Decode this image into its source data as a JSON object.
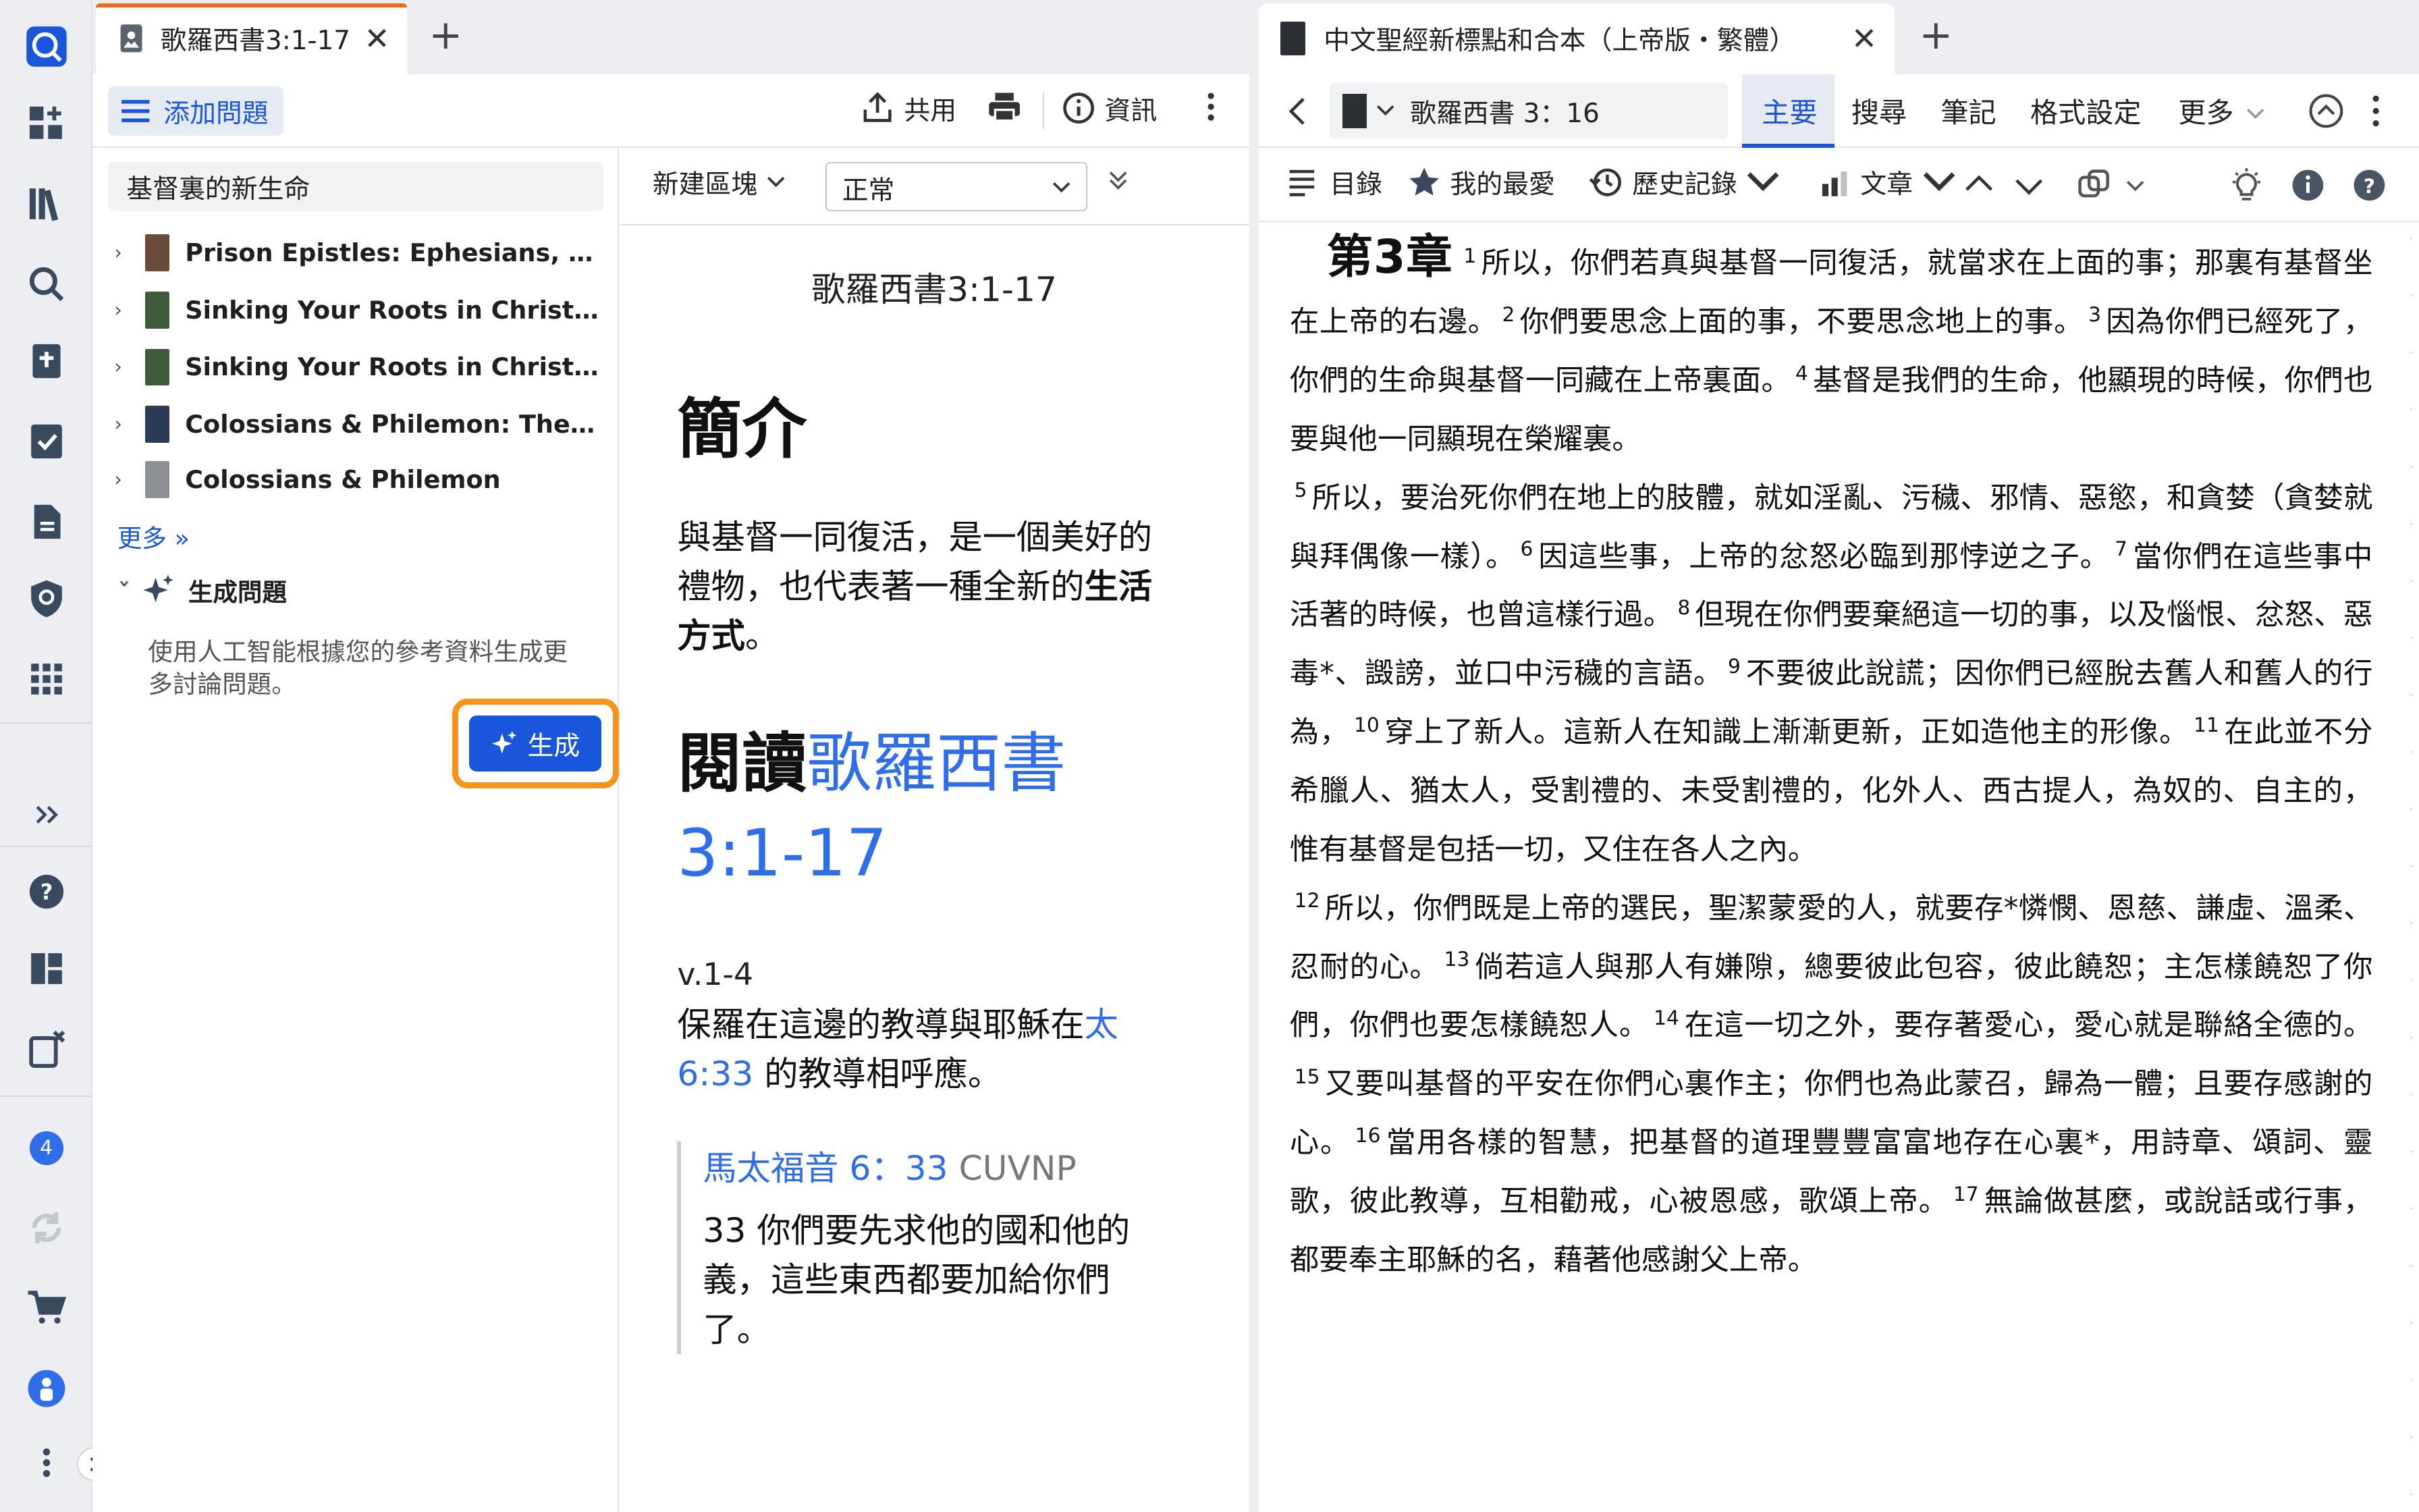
{
  "left_panel": {
    "tab_title": "歌羅西書3:1-17",
    "toolbar": {
      "add_question": "添加問題",
      "share": "共用",
      "info": "資訊"
    },
    "sidebar": {
      "search_value": "基督裏的新生命",
      "resources": [
        {
          "title": "Prison Epistles: Ephesians, Phili…",
          "color": "#6b4a3a"
        },
        {
          "title": "Sinking Your Roots in Christ: A …",
          "color": "#3f5a3a"
        },
        {
          "title": "Sinking Your Roots in Christ: A …",
          "color": "#3f5a3a"
        },
        {
          "title": "Colossians & Philemon: The Lor…",
          "color": "#2b3a55"
        },
        {
          "title": "Colossians & Philemon",
          "color": "#8c8f94"
        }
      ],
      "more_link": "更多 »",
      "generate_heading": "生成問題",
      "generate_desc": "使用人工智能根據您的參考資料生成更多討論問題。",
      "generate_button": "生成"
    },
    "doc": {
      "new_block": "新建區塊",
      "style_select": "正常",
      "title": "歌羅西書3:1-17",
      "intro_heading": "簡介",
      "intro_text_1": "與基督一同復活，是一個美好的禮物，也代表著一種全新的",
      "intro_text_bold": "生活方式",
      "intro_text_end": "。",
      "read_prefix": "閱讀",
      "read_link": "歌羅西書 3:1-17",
      "verse_label": "v.1-4",
      "verse_text_1": "保羅在這邊的教導與耶穌在",
      "verse_link": "太 6:33",
      "verse_text_2": " 的教導相呼應。",
      "quote_ref": "馬太福音 6：33",
      "quote_version": " CUVNP",
      "quote_text": "33 你們要先求他的國和他的義，這些東西都要加給你們了。"
    }
  },
  "right_panel": {
    "tab_title": "中文聖經新標點和合本（上帝版・繁體）",
    "reference": "歌羅西書 3：16",
    "tabs": [
      "主要",
      "搜尋",
      "筆記",
      "格式設定",
      "更多"
    ],
    "toolbar2": {
      "toc": "目錄",
      "favorites": "我的最愛",
      "history": "歷史記錄",
      "text": "文章"
    },
    "chapter_label": "第3章",
    "verses": [
      {
        "n": "1",
        "t": "所以，你們若真與基督一同復活，就當求在上面的事；那裏有基督坐在上帝的右邊。"
      },
      {
        "n": "2",
        "t": "你們要思念上面的事，不要思念地上的事。"
      },
      {
        "n": "3",
        "t": "因為你們已經死了，你們的生命與基督一同藏在上帝裏面。"
      },
      {
        "n": "4",
        "t": "基督是我們的生命，他顯現的時候，你們也要與他一同顯現在榮耀裏。"
      },
      {
        "n": "5",
        "t": "所以，要治死你們在地上的肢體，就如淫亂、污穢、邪情、惡慾，和貪婪（貪婪就與拜偶像一樣）。"
      },
      {
        "n": "6",
        "t": "因這些事，上帝的忿怒必臨到那悖逆之子。"
      },
      {
        "n": "7",
        "t": "當你們在這些事中活著的時候，也曾這樣行過。"
      },
      {
        "n": "8",
        "t": "但現在你們要棄絕這一切的事，以及惱恨、忿怒、惡毒*、譭謗，並口中污穢的言語。"
      },
      {
        "n": "9",
        "t": "不要彼此說謊；因你們已經脫去舊人和舊人的行為，"
      },
      {
        "n": "10",
        "t": "穿上了新人。這新人在知識上漸漸更新，正如造他主的形像。"
      },
      {
        "n": "11",
        "t": "在此並不分希臘人、猶太人，受割禮的、未受割禮的，化外人、西古提人，為奴的、自主的，惟有基督是包括一切，又住在各人之內。"
      },
      {
        "n": "12",
        "t": "所以，你們既是上帝的選民，聖潔蒙愛的人，就要存*憐憫、恩慈、謙虛、溫柔、忍耐的心。"
      },
      {
        "n": "13",
        "t": "倘若這人與那人有嫌隙，總要彼此包容，彼此饒恕；主怎樣饒恕了你們，你們也要怎樣饒恕人。"
      },
      {
        "n": "14",
        "t": "在這一切之外，要存著愛心，愛心就是聯絡全德的。"
      },
      {
        "n": "15",
        "t": "又要叫基督的平安在你們心裏作主；你們也為此蒙召，歸為一體；且要存感謝的心。"
      },
      {
        "n": "16",
        "t": "當用各樣的智慧，把基督的道理豐豐富富地存在心裏*，用詩章、頌詞、靈歌，彼此教導，互相勸戒，心被恩感，歌頌上帝。"
      },
      {
        "n": "17",
        "t": "無論做甚麼，或說話或行事，都要奉主耶穌的名，藉著他感謝父上帝。"
      }
    ]
  },
  "rail": {
    "badge_count": "4"
  }
}
